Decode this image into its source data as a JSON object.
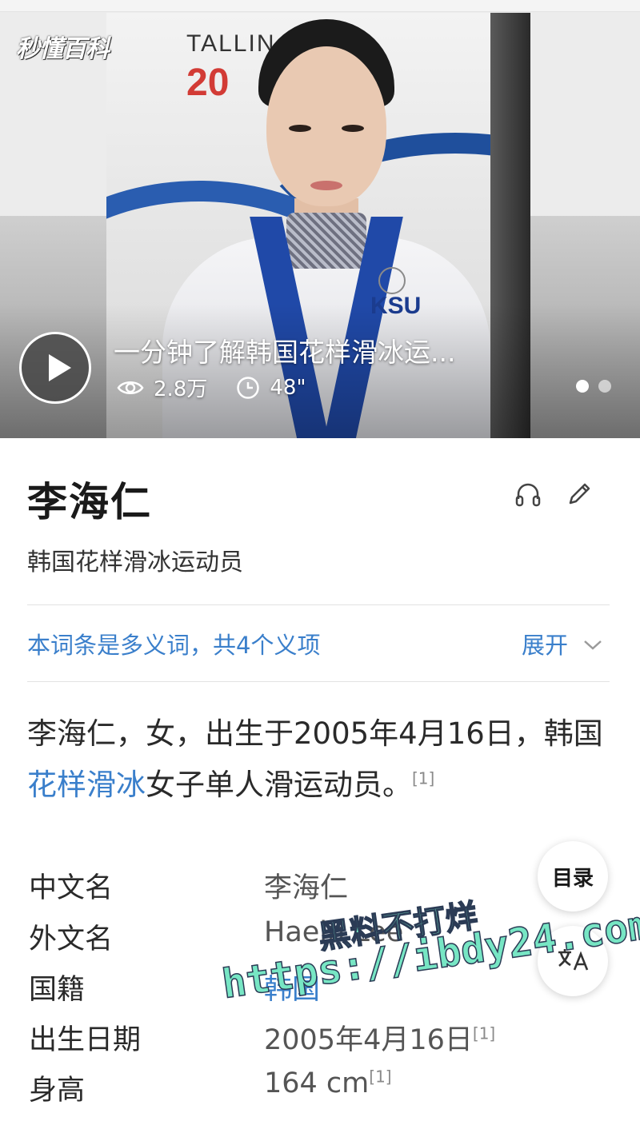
{
  "hero": {
    "logo_text": "秒懂百科",
    "video_title": "一分钟了解韩国花样滑冰运...",
    "views": "2.8万",
    "duration": "48\"",
    "photo_text_top": "TALLIN",
    "photo_text_year": "20",
    "photo_text_ksu": "KSU",
    "icons": {
      "play": "play-icon",
      "views": "eye-icon",
      "duration": "clock-icon"
    }
  },
  "header": {
    "name": "李海仁",
    "subtitle": "韩国花样滑冰运动员",
    "icons": [
      "headphones-icon",
      "pencil-icon"
    ]
  },
  "polysemy": {
    "text": "本词条是多义词，共4个义项",
    "expand_label": "展开"
  },
  "intro": {
    "part1": "李海仁，女，出生于2005年4月16日，韩国",
    "link": "花样滑冰",
    "part2": "女子单人滑运动员。",
    "ref": "[1]"
  },
  "infobox": [
    {
      "key": "中文名",
      "value": "李海仁",
      "ref": ""
    },
    {
      "key": "外文名",
      "value": "Haein Lee",
      "ref": ""
    },
    {
      "key": "国籍",
      "value": "韩国",
      "ref": ""
    },
    {
      "key": "出生日期",
      "value": "2005年4月16日",
      "ref": "[1]"
    },
    {
      "key": "身高",
      "value": "164 cm",
      "ref": "[1]"
    }
  ],
  "floating": {
    "toc_label": "目录"
  },
  "watermark": {
    "line1": "黑料不打烊",
    "line2": "https://ibdy24.com"
  },
  "colors": {
    "link": "#3a7fcb",
    "watermark": "#77e6c4"
  }
}
